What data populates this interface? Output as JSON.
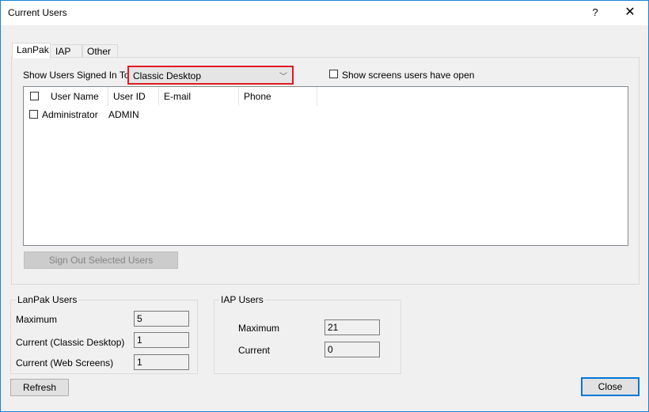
{
  "window": {
    "title": "Current Users",
    "help_label": "?",
    "close_label": "✕"
  },
  "tabs": [
    {
      "label": "LanPak",
      "active": true
    },
    {
      "label": "IAP",
      "active": false
    },
    {
      "label": "Other",
      "active": false
    }
  ],
  "lanpak_tab": {
    "show_label": "Show Users Signed In To",
    "combo_value": "Classic Desktop",
    "combo_arrow": "﹀",
    "highlight_color": "#e01a22",
    "show_screens_label": "Show screens users have open",
    "show_screens_checked": false,
    "columns": [
      "User Name",
      "User ID",
      "E-mail",
      "Phone"
    ],
    "rows": [
      {
        "checked": false,
        "user_name": "Administrator",
        "user_id": "ADMIN",
        "email": "",
        "phone": ""
      }
    ],
    "sign_out_label": "Sign Out Selected Users"
  },
  "lanpak_users": {
    "title": "LanPak Users",
    "maximum_label": "Maximum",
    "maximum_value": "5",
    "current_classic_label": "Current (Classic Desktop)",
    "current_classic_value": "1",
    "current_web_label": "Current (Web Screens)",
    "current_web_value": "1"
  },
  "iap_users": {
    "title": "IAP Users",
    "maximum_label": "Maximum",
    "maximum_value": "21",
    "current_label": "Current",
    "current_value": "0"
  },
  "buttons": {
    "refresh": "Refresh",
    "close": "Close"
  }
}
